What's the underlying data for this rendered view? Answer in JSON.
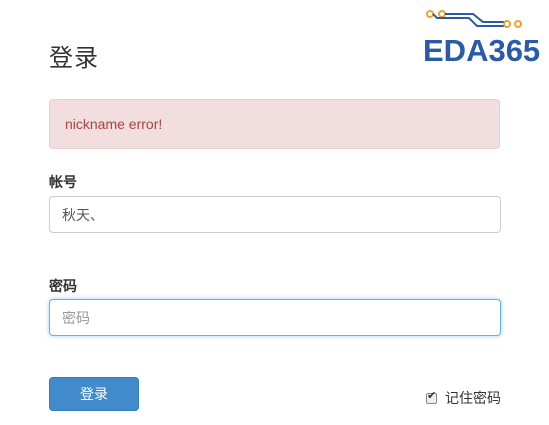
{
  "header": {
    "title": "登录",
    "logo_text": "EDA365"
  },
  "alert": {
    "message": "nickname error!"
  },
  "form": {
    "account_label": "帐号",
    "account_value": "秋天、",
    "password_label": "密码",
    "password_placeholder": "密码",
    "submit_label": "登录",
    "remember_label": "记住密码",
    "remember_checked": true
  },
  "colors": {
    "brand": "#2a5aa8",
    "logo_accent": "#f0a030",
    "alert_bg": "#f2dede",
    "alert_text": "#a94442",
    "primary_button": "#428bca"
  }
}
